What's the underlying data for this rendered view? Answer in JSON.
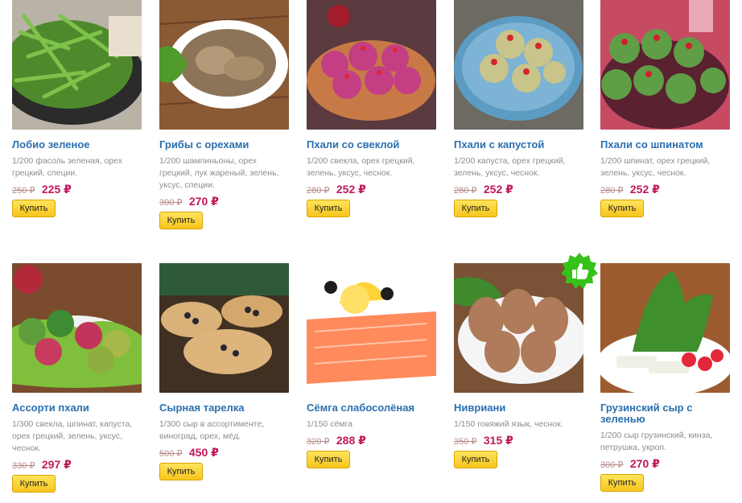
{
  "products": [
    {
      "title": "Лобио зеленое",
      "desc": "1/200 фасоль зеленая, орех грецкий, специи.",
      "old": "250 ₽",
      "price": "225 ₽",
      "buy": "Купить"
    },
    {
      "title": "Грибы с орехами",
      "desc": "1/200 шампиньоны, орех грецкий, лук жареный, зелень, уксус, специи.",
      "old": "300 ₽",
      "price": "270 ₽",
      "buy": "Купить"
    },
    {
      "title": "Пхали со свеклой",
      "desc": "1/200 свекла, орех грецкий, зелень, уксус, чеснок.",
      "old": "280 ₽",
      "price": "252 ₽",
      "buy": "Купить"
    },
    {
      "title": "Пхали с капустой",
      "desc": "1/200 капуста, орех грецкий, зелень, уксус, чеснок.",
      "old": "280 ₽",
      "price": "252 ₽",
      "buy": "Купить"
    },
    {
      "title": "Пхали со шпинатом",
      "desc": "1/200 шпинат, орех грецкий, зелень, уксус, чеснок.",
      "old": "280 ₽",
      "price": "252 ₽",
      "buy": "Купить"
    },
    {
      "title": "Ассорти пхали",
      "desc": "1/300 свекла, шпинат, капуста, орех грецкий, зелень, уксус, чеснок.",
      "old": "330 ₽",
      "price": "297 ₽",
      "buy": "Купить"
    },
    {
      "title": "Сырная тарелка",
      "desc": "1/300 сыр в ассортименте, виноград, орех, мёд.",
      "old": "500 ₽",
      "price": "450 ₽",
      "buy": "Купить"
    },
    {
      "title": "Сёмга слабосолёная",
      "desc": "1/150 сёмга",
      "old": "320 ₽",
      "price": "288 ₽",
      "buy": "Купить"
    },
    {
      "title": "Нивриани",
      "desc": "1/150 говяжий язык, чеснок.",
      "old": "350 ₽",
      "price": "315 ₽",
      "buy": "Купить"
    },
    {
      "title": "Грузинский сыр с зеленью",
      "desc": "1/200 сыр грузинский, кинза, петрушка, укроп.",
      "old": "300 ₽",
      "price": "270 ₽",
      "buy": "Купить"
    }
  ],
  "icons": {
    "recommend_badge": "thumbs-up-icon"
  }
}
